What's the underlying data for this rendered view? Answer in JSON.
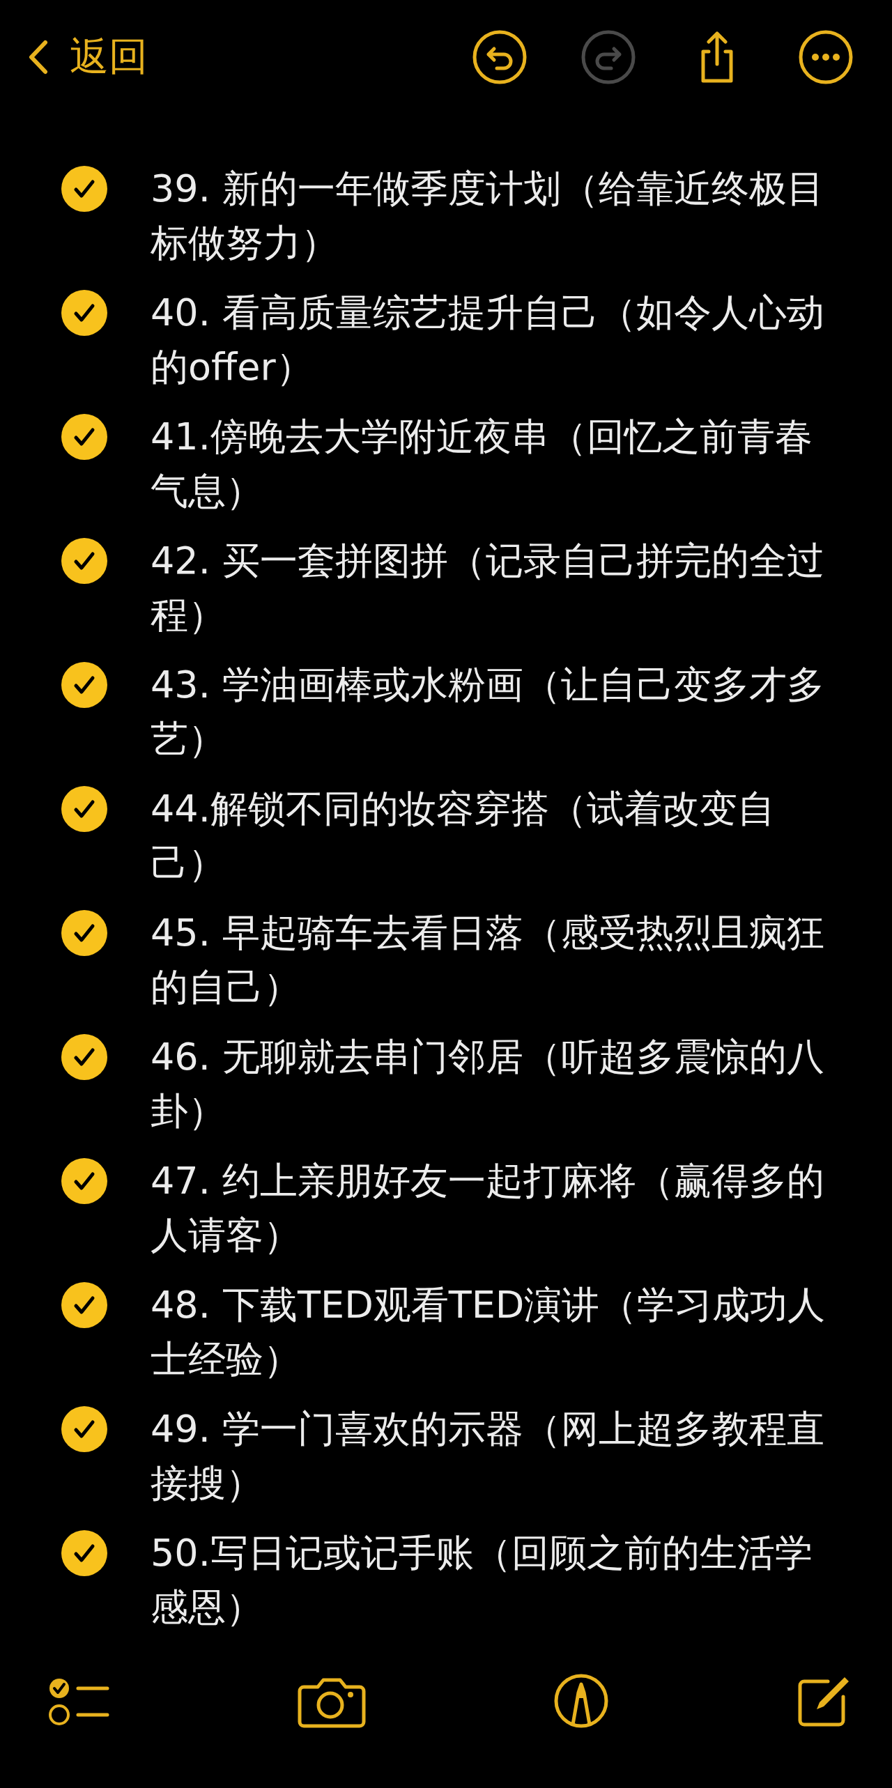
{
  "nav": {
    "back_label": "返回",
    "undo": {
      "disabled": false
    },
    "redo": {
      "disabled": true
    }
  },
  "items": [
    {
      "text": "39. 新的一年做季度计划（给靠近终极目标做努力）",
      "checked": true
    },
    {
      "text": "40. 看高质量综艺提升自己（如令人心动的offer）",
      "checked": true
    },
    {
      "text": "41.傍晚去大学附近夜串（回忆之前青春气息）",
      "checked": true
    },
    {
      "text": "42. 买一套拼图拼（记录自己拼完的全过程）",
      "checked": true
    },
    {
      "text": "43. 学油画棒或水粉画（让自己变多才多艺）",
      "checked": true
    },
    {
      "text": "44.解锁不同的妆容穿搭（试着改变自己）",
      "checked": true
    },
    {
      "text": "45. 早起骑车去看日落（感受热烈且疯狂的自己）",
      "checked": true
    },
    {
      "text": "46. 无聊就去串门邻居（听超多震惊的八卦）",
      "checked": true
    },
    {
      "text": "47. 约上亲朋好友一起打麻将（赢得多的人请客）",
      "checked": true
    },
    {
      "text": "48. 下载TED观看TED演讲（学习成功人士经验）",
      "checked": true
    },
    {
      "text": "49. 学一门喜欢的示器（网上超多教程直接搜）",
      "checked": true
    },
    {
      "text": "50.写日记或记手账（回顾之前的生活学感恩）",
      "checked": true
    }
  ]
}
